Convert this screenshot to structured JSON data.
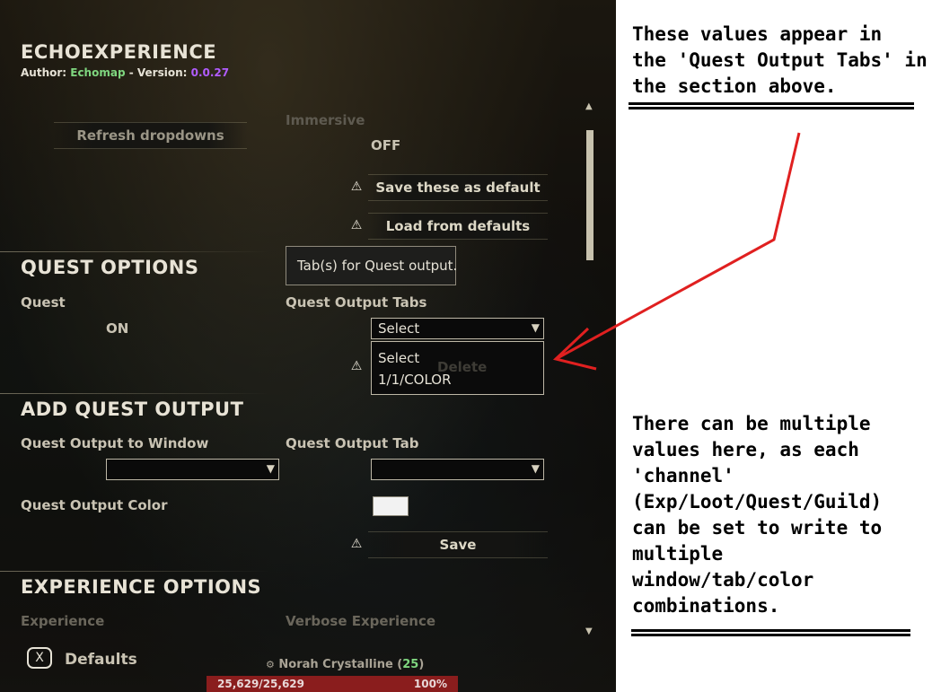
{
  "addon": {
    "title": "ECHOEXPERIENCE",
    "author_prefix": "Author: ",
    "author_name": "Echomap",
    "version_sep": " - Version: ",
    "version": "0.0.27"
  },
  "top": {
    "refresh_label": "Refresh dropdowns",
    "immersive_label": "Immersive",
    "immersive_value": "OFF",
    "save_default_label": "Save these as default",
    "load_defaults_label": "Load from defaults"
  },
  "quest_options": {
    "header": "QUEST OPTIONS",
    "quest_label": "Quest",
    "quest_value": "ON",
    "tabs_label": "Quest Output Tabs",
    "tabs_select": "Select",
    "tooltip": "Tab(s) for Quest output.",
    "dropdown_options": [
      "Select",
      "1/1/COLOR"
    ],
    "delete_label": "Delete"
  },
  "add_quest_output": {
    "header": "ADD QUEST OUTPUT",
    "window_label": "Quest Output to Window",
    "tab_label": "Quest Output Tab",
    "color_label": "Quest Output Color",
    "save_label": "Save"
  },
  "experience_options": {
    "header": "EXPERIENCE OPTIONS",
    "experience_label": "Experience",
    "verbose_label": "Verbose Experience"
  },
  "footer": {
    "key": "X",
    "defaults_label": "Defaults",
    "player_name": "Norah Crystalline",
    "player_level": "25",
    "health": "25,629/25,629",
    "health_pct": "100%"
  },
  "annotations": {
    "top_note": "These values appear in\nthe 'Quest Output Tabs' in\nthe section above.",
    "bottom_note": "There can be multiple\nvalues here, as each\n'channel'\n(Exp/Loot/Quest/Guild)\ncan be set to write to\nmultiple\nwindow/tab/color\ncombinations."
  },
  "colors": {
    "author_name": "#7fd67f",
    "version": "#b15cff",
    "level": "#7fd67f",
    "arrow": "#e02020",
    "health_bar": "#8a1d1d"
  }
}
